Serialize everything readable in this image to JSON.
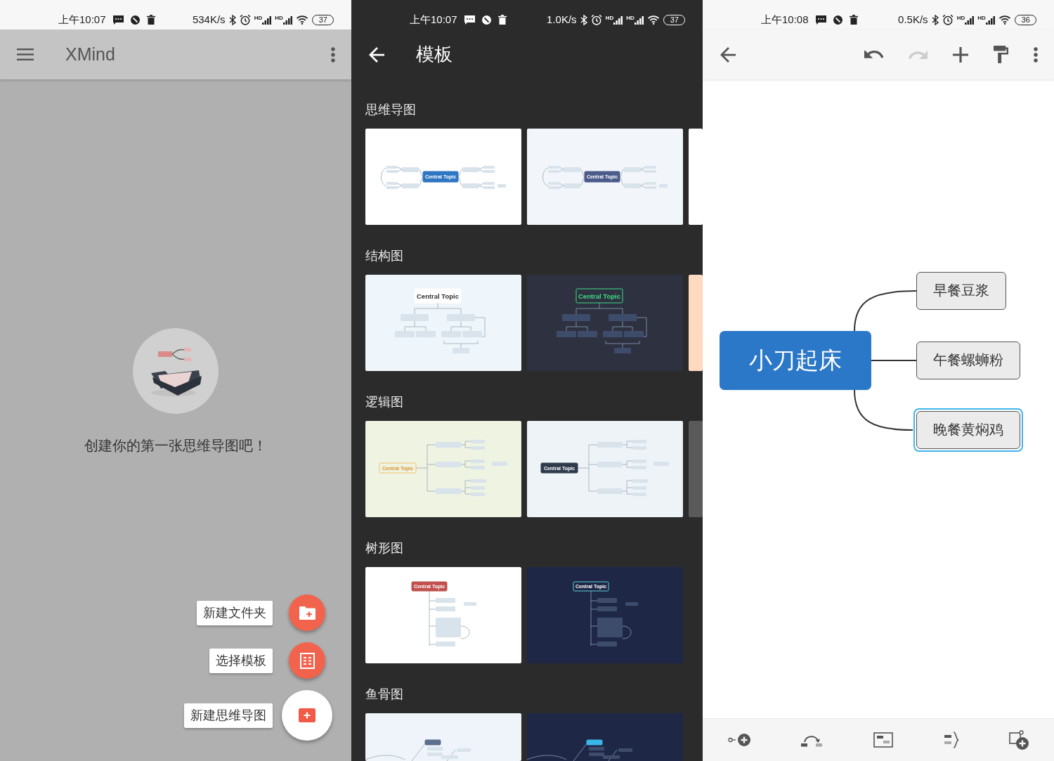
{
  "home_screen": {
    "status_bar": {
      "time": "上午10:07",
      "speed": "534K/s",
      "signals": [
        {
          "network_type": "HD"
        },
        {
          "network_type": "HD"
        }
      ],
      "battery": "37"
    },
    "app_bar": {
      "title": "XMind"
    },
    "empty_state": {
      "message": "创建你的第一张思维导图吧！"
    },
    "fab_menu": [
      {
        "kind": "folder",
        "label": "新建文件夹"
      },
      {
        "kind": "template",
        "label": "选择模板"
      },
      {
        "kind": "mind_map",
        "label": "新建思维导图"
      }
    ]
  },
  "templates_screen": {
    "status_bar": {
      "time": "上午10:07",
      "speed": "1.0K/s",
      "signals": [
        {
          "network_type": "HD"
        },
        {
          "network_type": "HD"
        }
      ],
      "battery": "37"
    },
    "app_bar": {
      "title": "模板"
    },
    "sections": [
      {
        "title": "思维导图",
        "kind": "mind_map",
        "thumbnails": [
          {
            "color": "#ffffff",
            "label": "Central Topic"
          },
          {
            "color": "#f2f6fb",
            "label": "Central Topic"
          },
          {
            "color": "#ffffff"
          }
        ]
      },
      {
        "title": "结构图",
        "kind": "org_chart",
        "thumbnails": [
          {
            "color": "#eef6fb",
            "label": "Central Topic"
          },
          {
            "color": "#2e3140",
            "label": "Central Topic"
          },
          {
            "color": "#ffd9c0"
          }
        ]
      },
      {
        "title": "逻辑图",
        "kind": "logic_chart",
        "thumbnails": [
          {
            "color": "#eef3e2",
            "label": "Central Topic"
          },
          {
            "color": "#eef3f8",
            "label": "Central Topic"
          },
          {
            "color": "#5a5a5a"
          }
        ]
      },
      {
        "title": "树形图",
        "kind": "tree_chart",
        "thumbnails": [
          {
            "color": "#ffffff",
            "label": "Central Topic"
          },
          {
            "color": "#1f2747",
            "label": "Central Topic"
          }
        ]
      },
      {
        "title": "鱼骨图",
        "kind": "fishbone",
        "thumbnails": [
          {
            "color": "#eef4fa"
          },
          {
            "color": "#1f2747"
          }
        ]
      }
    ]
  },
  "editor_screen": {
    "status_bar": {
      "time": "上午10:08",
      "speed": "0.5K/s",
      "signals": [
        {
          "network_type": "HD"
        },
        {
          "network_type": "HD"
        }
      ],
      "battery": "36"
    },
    "toolbar": [
      {
        "kind": "undo",
        "disabled": false
      },
      {
        "kind": "redo",
        "disabled": true
      },
      {
        "kind": "add",
        "disabled": false
      },
      {
        "kind": "format",
        "disabled": false
      }
    ],
    "mind_map": {
      "central_topic": "小刀起床",
      "topics": [
        {
          "label": "早餐豆浆",
          "selected": false
        },
        {
          "label": "午餐螺蛳粉",
          "selected": false
        },
        {
          "label": "晚餐黄焖鸡",
          "selected": true
        }
      ]
    }
  }
}
